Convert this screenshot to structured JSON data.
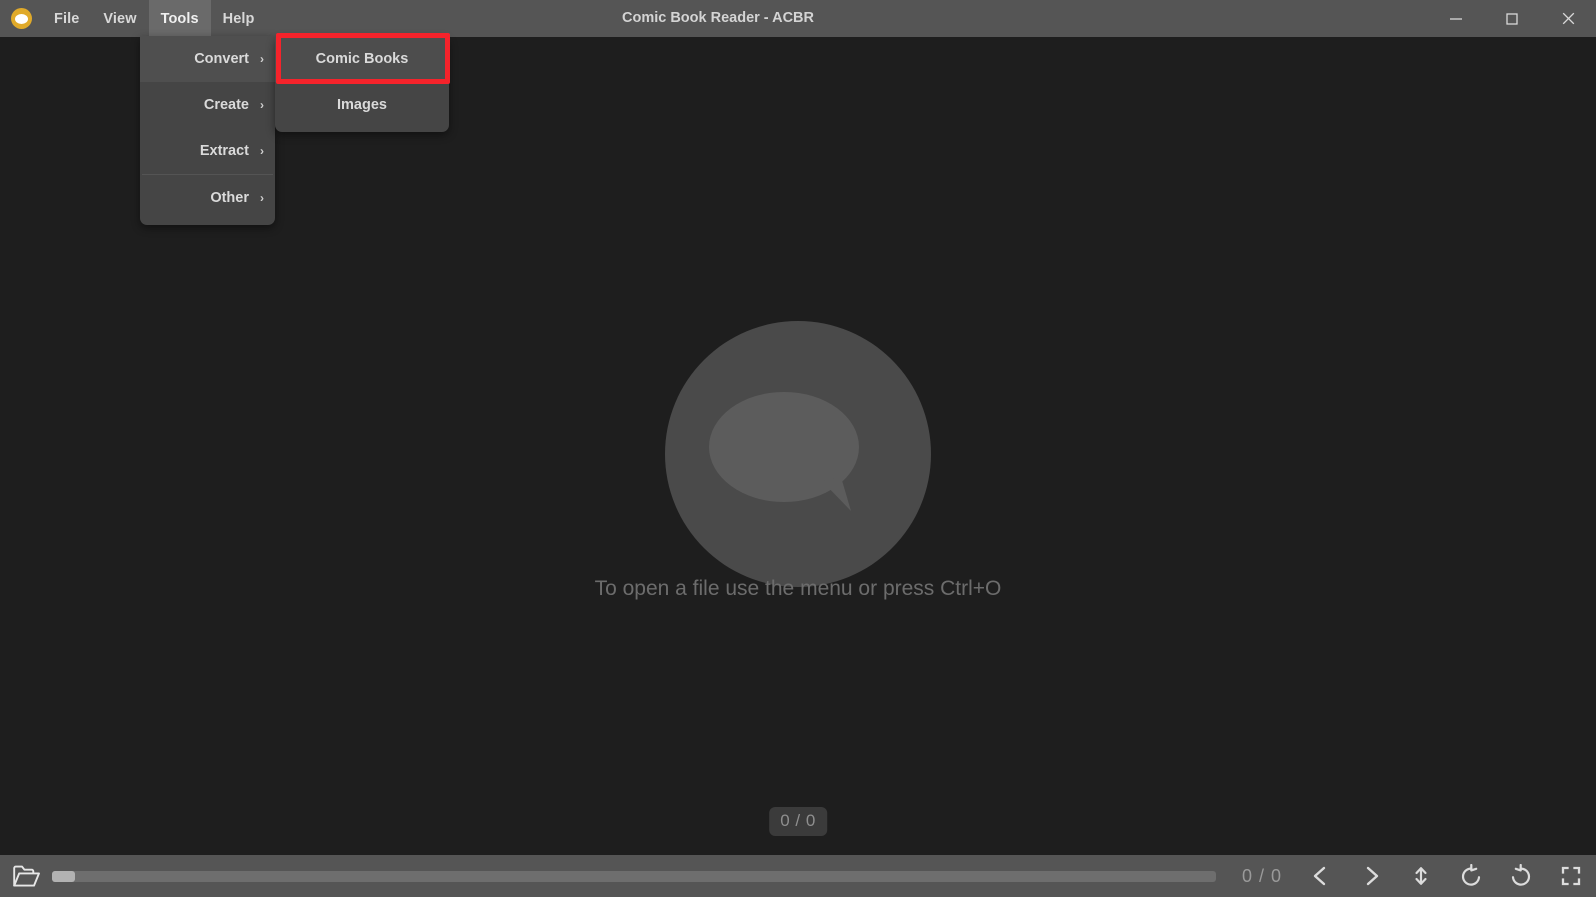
{
  "window": {
    "title": "Comic Book Reader - ACBR",
    "controls": [
      {
        "name": "minimize-button",
        "glyph": "minimize"
      },
      {
        "name": "maximize-button",
        "glyph": "maximize"
      },
      {
        "name": "close-button",
        "glyph": "close"
      }
    ]
  },
  "app_icon": {
    "name": "acbr-logo-icon",
    "color": "#e0aa2a"
  },
  "menubar": {
    "items": [
      {
        "label": "File",
        "active": false
      },
      {
        "label": "View",
        "active": false
      },
      {
        "label": "Tools",
        "active": true
      },
      {
        "label": "Help",
        "active": false
      }
    ]
  },
  "tools_menu": {
    "items": [
      {
        "label": "Convert",
        "submenu_indicator": "›",
        "highlighted": true
      },
      {
        "label": "Create",
        "submenu_indicator": "›",
        "highlighted": false
      },
      {
        "label": "Extract",
        "submenu_indicator": "›",
        "highlighted": false
      },
      {
        "label": "Other",
        "submenu_indicator": "›",
        "highlighted": false
      }
    ]
  },
  "convert_submenu": {
    "items": [
      {
        "label": "Comic Books",
        "selected": true,
        "highlighted_box": true
      },
      {
        "label": "Images",
        "selected": false,
        "highlighted_box": false
      }
    ]
  },
  "highlight": {
    "color": "#f5232b"
  },
  "main": {
    "empty_icon_name": "speech-bubble-placeholder-icon",
    "hint": "To open a file use the menu or press Ctrl+O",
    "page_badge": "0 / 0"
  },
  "bottombar": {
    "open_file_icon": "open-folder-icon",
    "scrollbar": {
      "thumb_percent": 2
    },
    "page_counter": "0 / 0",
    "buttons": [
      {
        "name": "previous-page-button",
        "icon": "chevron-left-icon"
      },
      {
        "name": "next-page-button",
        "icon": "chevron-right-icon"
      },
      {
        "name": "fit-height-button",
        "icon": "arrows-vertical-icon"
      },
      {
        "name": "rotate-left-button",
        "icon": "rotate-ccw-icon"
      },
      {
        "name": "rotate-right-button",
        "icon": "rotate-cw-icon"
      },
      {
        "name": "fullscreen-button",
        "icon": "fullscreen-icon"
      }
    ]
  },
  "colors": {
    "background": "#1e1e1e",
    "chrome": "#555555",
    "menu_panel": "#454545",
    "accent_highlight": "#f5232b",
    "logo": "#e0aa2a"
  }
}
